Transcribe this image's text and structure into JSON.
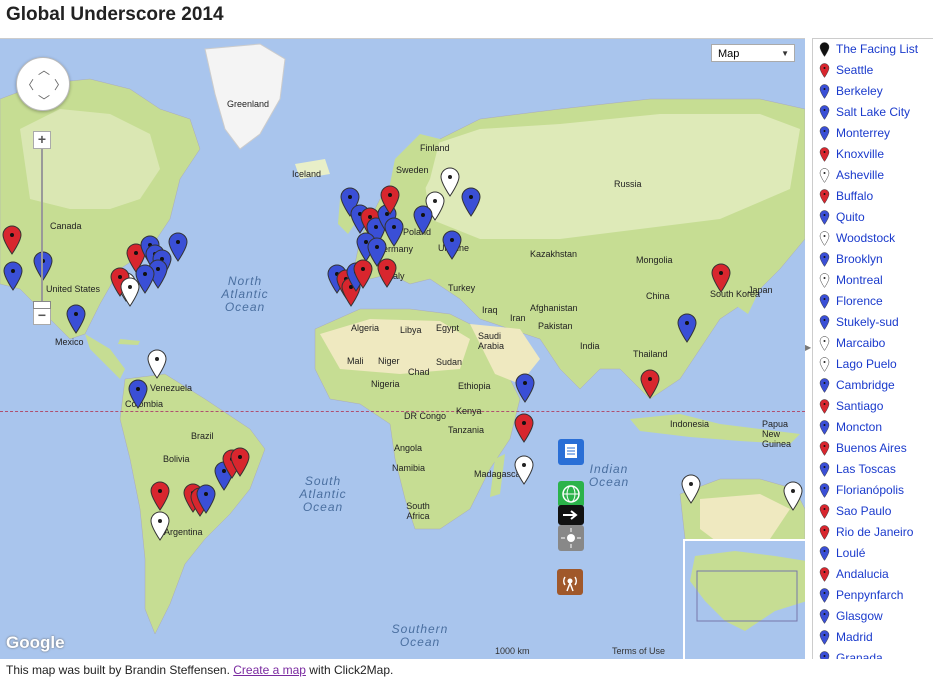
{
  "page": {
    "title": "Global Underscore 2014"
  },
  "map_controls": {
    "maptype_label": "Map",
    "zoom_in": "+",
    "zoom_out": "−",
    "scale_text": "1000 km",
    "terms_text": "Terms of Use",
    "logo_text": "Google"
  },
  "map_labels": {
    "places": [
      {
        "text": "Greenland",
        "class": "country"
      },
      {
        "text": "Iceland",
        "class": "country"
      },
      {
        "text": "Sweden",
        "class": "country"
      },
      {
        "text": "Finland",
        "class": "country"
      },
      {
        "text": "Russia",
        "class": "country"
      },
      {
        "text": "Canada",
        "class": "country"
      },
      {
        "text": "United States",
        "class": "country"
      },
      {
        "text": "Mexico",
        "class": "country"
      },
      {
        "text": "Venezuela",
        "class": "country"
      },
      {
        "text": "Colombia",
        "class": "country"
      },
      {
        "text": "Brazil",
        "class": "country"
      },
      {
        "text": "Bolivia",
        "class": "country"
      },
      {
        "text": "Argentina",
        "class": "country"
      },
      {
        "text": "Poland",
        "class": "country"
      },
      {
        "text": "Germany",
        "class": "country"
      },
      {
        "text": "Ukraine",
        "class": "country"
      },
      {
        "text": "Italy",
        "class": "country"
      },
      {
        "text": "Turkey",
        "class": "country"
      },
      {
        "text": "Kazakhstan",
        "class": "country"
      },
      {
        "text": "Mongolia",
        "class": "country"
      },
      {
        "text": "China",
        "class": "country"
      },
      {
        "text": "South Korea",
        "class": "country"
      },
      {
        "text": "Japan",
        "class": "country"
      },
      {
        "text": "Algeria",
        "class": "country"
      },
      {
        "text": "Libya",
        "class": "country"
      },
      {
        "text": "Egypt",
        "class": "country"
      },
      {
        "text": "Saudi Arabia",
        "class": "country"
      },
      {
        "text": "Iraq",
        "class": "country"
      },
      {
        "text": "Iran",
        "class": "country"
      },
      {
        "text": "Afghanistan",
        "class": "country"
      },
      {
        "text": "Pakistan",
        "class": "country"
      },
      {
        "text": "India",
        "class": "country"
      },
      {
        "text": "Thailand",
        "class": "country"
      },
      {
        "text": "Mali",
        "class": "country"
      },
      {
        "text": "Niger",
        "class": "country"
      },
      {
        "text": "Chad",
        "class": "country"
      },
      {
        "text": "Sudan",
        "class": "country"
      },
      {
        "text": "Nigeria",
        "class": "country"
      },
      {
        "text": "Ethiopia",
        "class": "country"
      },
      {
        "text": "Kenya",
        "class": "country"
      },
      {
        "text": "DR Congo",
        "class": "country"
      },
      {
        "text": "Tanzania",
        "class": "country"
      },
      {
        "text": "Angola",
        "class": "country"
      },
      {
        "text": "Namibia",
        "class": "country"
      },
      {
        "text": "South Africa",
        "class": "country"
      },
      {
        "text": "Madagascar",
        "class": "country"
      },
      {
        "text": "Indonesia",
        "class": "country"
      },
      {
        "text": "Papua New Guinea",
        "class": "country"
      }
    ],
    "oceans": [
      {
        "text": "North Atlantic Ocean"
      },
      {
        "text": "South Atlantic Ocean"
      },
      {
        "text": "Indian Ocean"
      },
      {
        "text": "Southern Ocean"
      }
    ]
  },
  "colors": {
    "red": "#d8262e",
    "blue": "#3a4fd6",
    "white": "#ffffff"
  },
  "sidebar": {
    "items": [
      {
        "label": "The Facing List",
        "color": "black"
      },
      {
        "label": "Seattle",
        "color": "red"
      },
      {
        "label": "Berkeley",
        "color": "blue"
      },
      {
        "label": "Salt Lake City",
        "color": "blue"
      },
      {
        "label": "Monterrey",
        "color": "blue"
      },
      {
        "label": "Knoxville",
        "color": "red"
      },
      {
        "label": "Asheville",
        "color": "white"
      },
      {
        "label": "Buffalo",
        "color": "red"
      },
      {
        "label": "Quito",
        "color": "blue"
      },
      {
        "label": "Woodstock",
        "color": "white"
      },
      {
        "label": "Brooklyn",
        "color": "blue"
      },
      {
        "label": "Montreal",
        "color": "white"
      },
      {
        "label": "Florence",
        "color": "blue"
      },
      {
        "label": "Stukely-sud",
        "color": "blue"
      },
      {
        "label": "Marcaibo",
        "color": "white"
      },
      {
        "label": "Lago Puelo",
        "color": "white"
      },
      {
        "label": "Cambridge",
        "color": "blue"
      },
      {
        "label": "Santiago",
        "color": "red"
      },
      {
        "label": "Moncton",
        "color": "blue"
      },
      {
        "label": "Buenos Aires",
        "color": "red"
      },
      {
        "label": "Las Toscas",
        "color": "blue"
      },
      {
        "label": "Florianópolis",
        "color": "blue"
      },
      {
        "label": "Sao Paulo",
        "color": "red"
      },
      {
        "label": "Rio de Janeiro",
        "color": "red"
      },
      {
        "label": "Loulé",
        "color": "blue"
      },
      {
        "label": "Andalucia",
        "color": "red"
      },
      {
        "label": "Penpynfarch",
        "color": "blue"
      },
      {
        "label": "Glasgow",
        "color": "blue"
      },
      {
        "label": "Madrid",
        "color": "blue"
      },
      {
        "label": "Granada",
        "color": "blue"
      }
    ]
  },
  "footer": {
    "prefix": "This map was built by Brandin Steffensen.",
    "link": "Create a map",
    "suffix": "with Click2Map."
  }
}
